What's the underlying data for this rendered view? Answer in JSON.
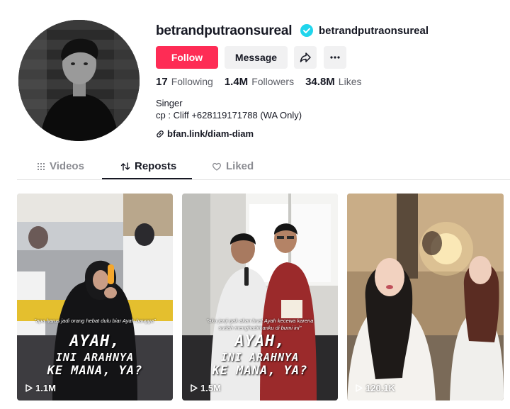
{
  "profile": {
    "username": "betrandputraonsureal",
    "nickname": "betrandputraonsureal",
    "verified_icon": "verified-badge-icon"
  },
  "actions": {
    "follow_label": "Follow",
    "message_label": "Message",
    "share_icon": "share-arrow-icon",
    "more_icon": "more-dots-icon"
  },
  "stats": {
    "following_count": "17",
    "following_label": "Following",
    "followers_count": "1.4M",
    "followers_label": "Followers",
    "likes_count": "34.8M",
    "likes_label": "Likes"
  },
  "bio": {
    "line1": "Singer",
    "line2": "cp : Cliff +628119171788 (WA Only)",
    "link": "bfan.link/diam-diam"
  },
  "tabs": [
    {
      "label": "Videos",
      "icon": "grid-icon"
    },
    {
      "label": "Reposts",
      "icon": "repost-icon",
      "active": true
    },
    {
      "label": "Liked",
      "icon": "heart-icon"
    }
  ],
  "videos": [
    {
      "caption": "\"apa harus jadi orang hebat dulu biar Ayah bangga\"",
      "headline1": "AYAH,",
      "headline2": "INI ARAHNYA",
      "headline3": "KE MANA, YA?",
      "views": "1.1M"
    },
    {
      "caption": "\"aku janji gak akan buat Ayah kecewa karena sudah menghadirkanku di bumi ini\"",
      "headline1": "AYAH,",
      "headline2": "INI ARAHNYA",
      "headline3": "KE MANA, YA?",
      "views": "1.5M"
    },
    {
      "views": "120.1K"
    }
  ],
  "colors": {
    "accent": "#fe2c55",
    "verified": "#20d5ec",
    "text": "#161823",
    "muted": "#8a8b91"
  }
}
